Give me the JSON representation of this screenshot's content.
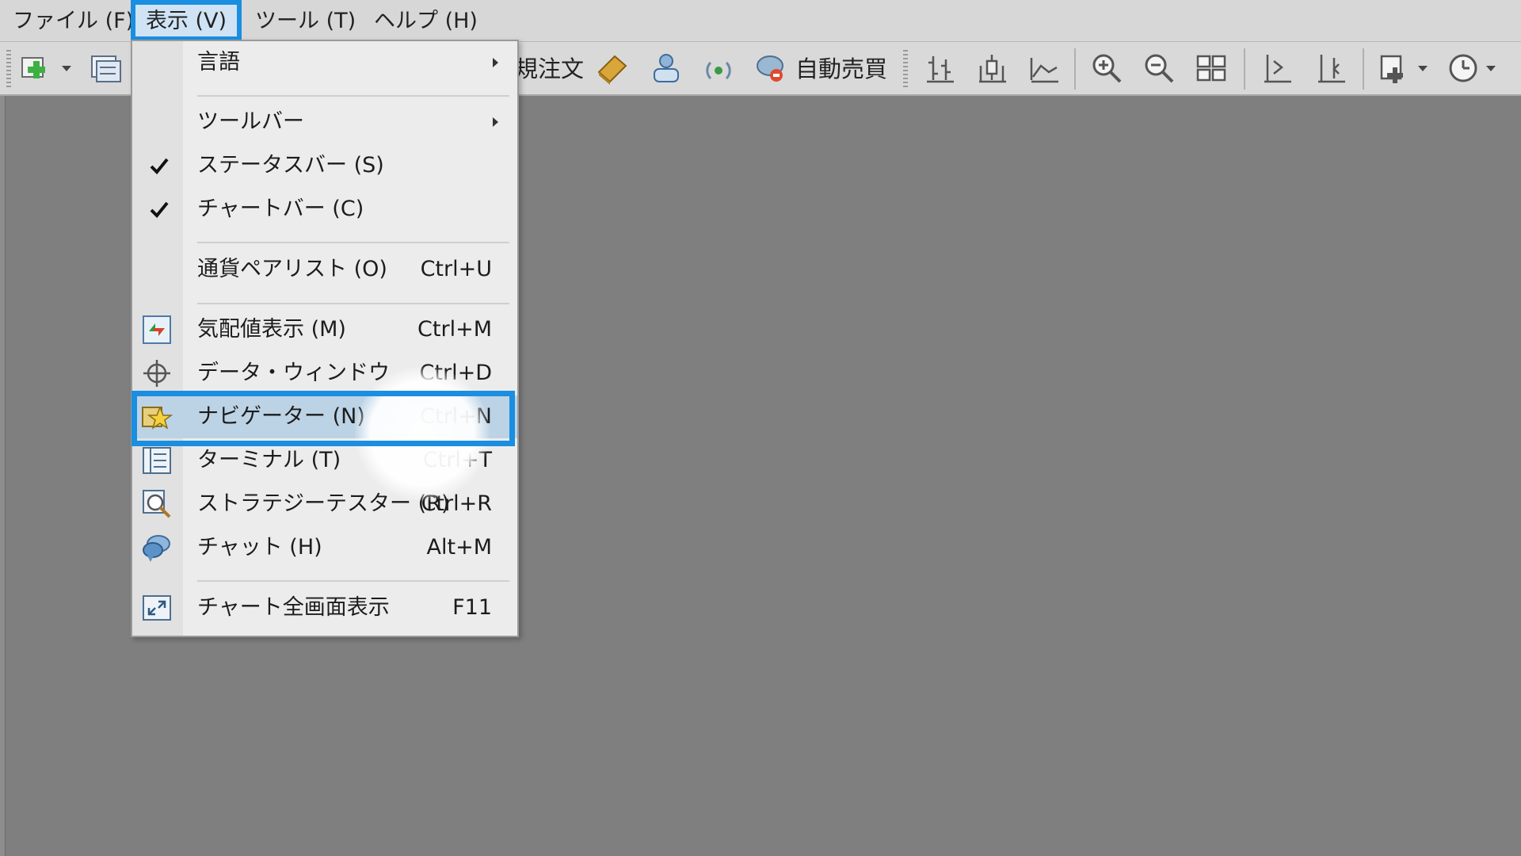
{
  "menubar": {
    "file": "ファイル (F)",
    "view": "表示 (V)",
    "tools": "ツール (T)",
    "help": "ヘルプ (H)"
  },
  "toolbar": {
    "new_order_partial": "規注文",
    "auto_trading": "自動売買",
    "icons": [
      "new-chart-icon",
      "profiles-icon",
      "book-icon",
      "account-icon",
      "signal-icon",
      "auto-trading-icon",
      "bar-chart-icon",
      "candlestick-icon",
      "line-chart-icon",
      "zoom-in-icon",
      "zoom-out-icon",
      "tile-windows-icon",
      "chart-shift-icon",
      "autoscroll-icon",
      "indicators-icon",
      "periods-clock-icon"
    ]
  },
  "view_menu": {
    "items": [
      {
        "label": "言語",
        "shortcut": "",
        "submenu": true,
        "checked": false,
        "icon": ""
      },
      {
        "label": "ツールバー",
        "shortcut": "",
        "submenu": true,
        "checked": false,
        "icon": ""
      },
      {
        "label": "ステータスバー (S)",
        "shortcut": "",
        "submenu": false,
        "checked": true,
        "icon": ""
      },
      {
        "label": "チャートバー (C)",
        "shortcut": "",
        "submenu": false,
        "checked": true,
        "icon": ""
      },
      {
        "label": "通貨ペアリスト (O)",
        "shortcut": "Ctrl+U",
        "submenu": false,
        "checked": false,
        "icon": ""
      },
      {
        "label": "気配値表示 (M)",
        "shortcut": "Ctrl+M",
        "submenu": false,
        "checked": false,
        "icon": "market-watch-icon"
      },
      {
        "label": "データ・ウィンドウ",
        "shortcut": "Ctrl+D",
        "submenu": false,
        "checked": false,
        "icon": "crosshair-icon"
      },
      {
        "label": "ナビゲーター (N)",
        "shortcut": "Ctrl+N",
        "submenu": false,
        "checked": false,
        "icon": "navigator-star-icon",
        "highlighted": true
      },
      {
        "label": "ターミナル (T)",
        "shortcut": "Ctrl+T",
        "submenu": false,
        "checked": false,
        "icon": "terminal-icon"
      },
      {
        "label": "ストラテジーテスター (R)",
        "shortcut": "Ctrl+R",
        "submenu": false,
        "checked": false,
        "icon": "strategy-tester-icon"
      },
      {
        "label": "チャット (H)",
        "shortcut": "Alt+M",
        "submenu": false,
        "checked": false,
        "icon": "chat-bubble-icon"
      },
      {
        "label": "チャート全画面表示",
        "shortcut": "F11",
        "submenu": false,
        "checked": false,
        "icon": "fullscreen-icon"
      }
    ]
  },
  "colors": {
    "highlight_frame": "#1a8ee0",
    "menu_highlight": "#bcd3e6",
    "workspace": "#7f7f7f"
  }
}
